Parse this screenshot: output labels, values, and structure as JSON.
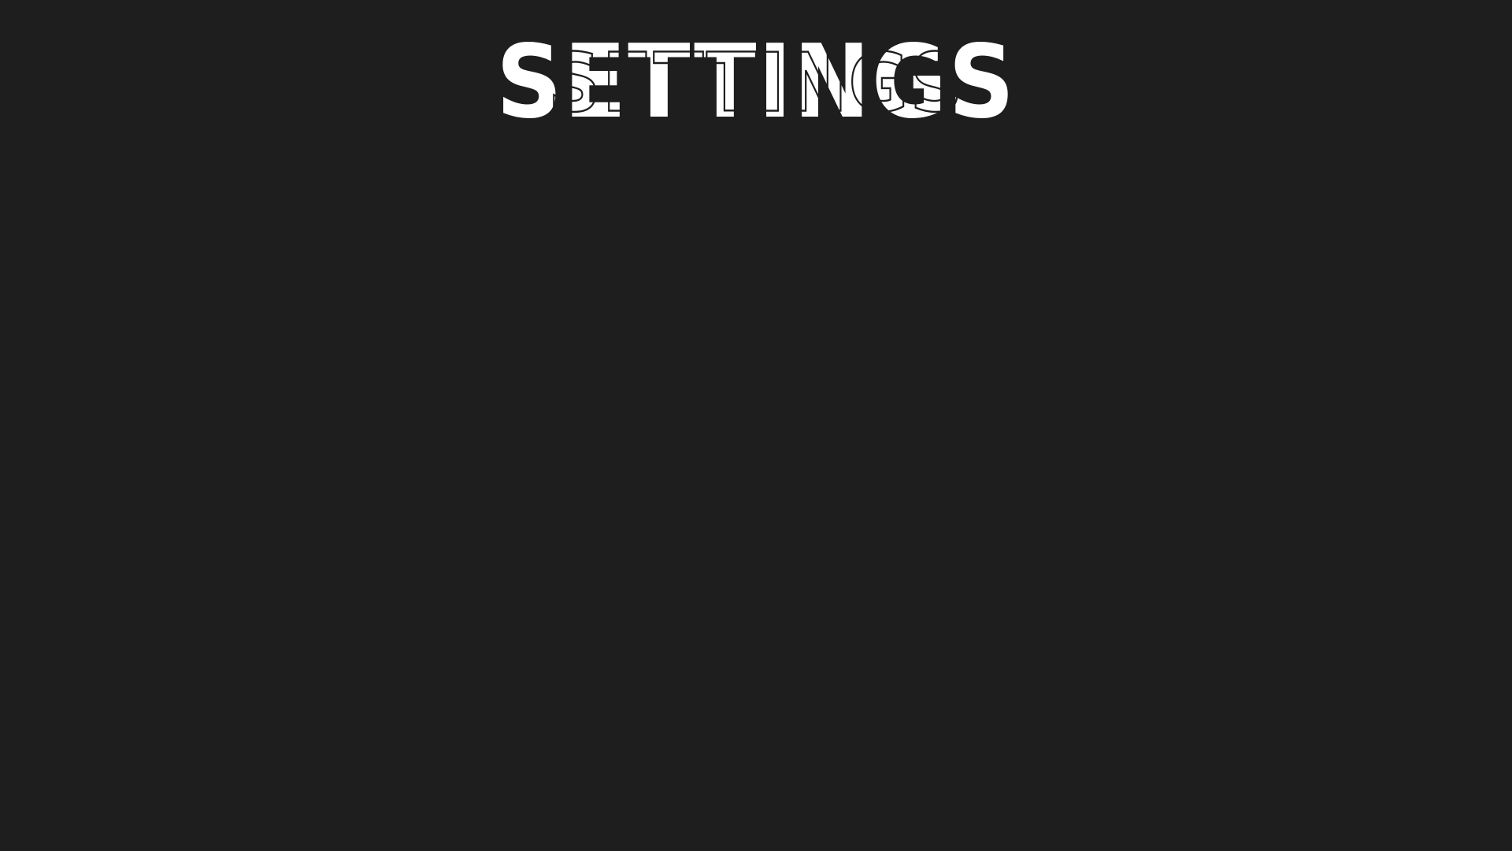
{
  "screen": {
    "title": "SETTINGS",
    "background_color": "#1e1e1e",
    "title_color": "#ffffff"
  }
}
